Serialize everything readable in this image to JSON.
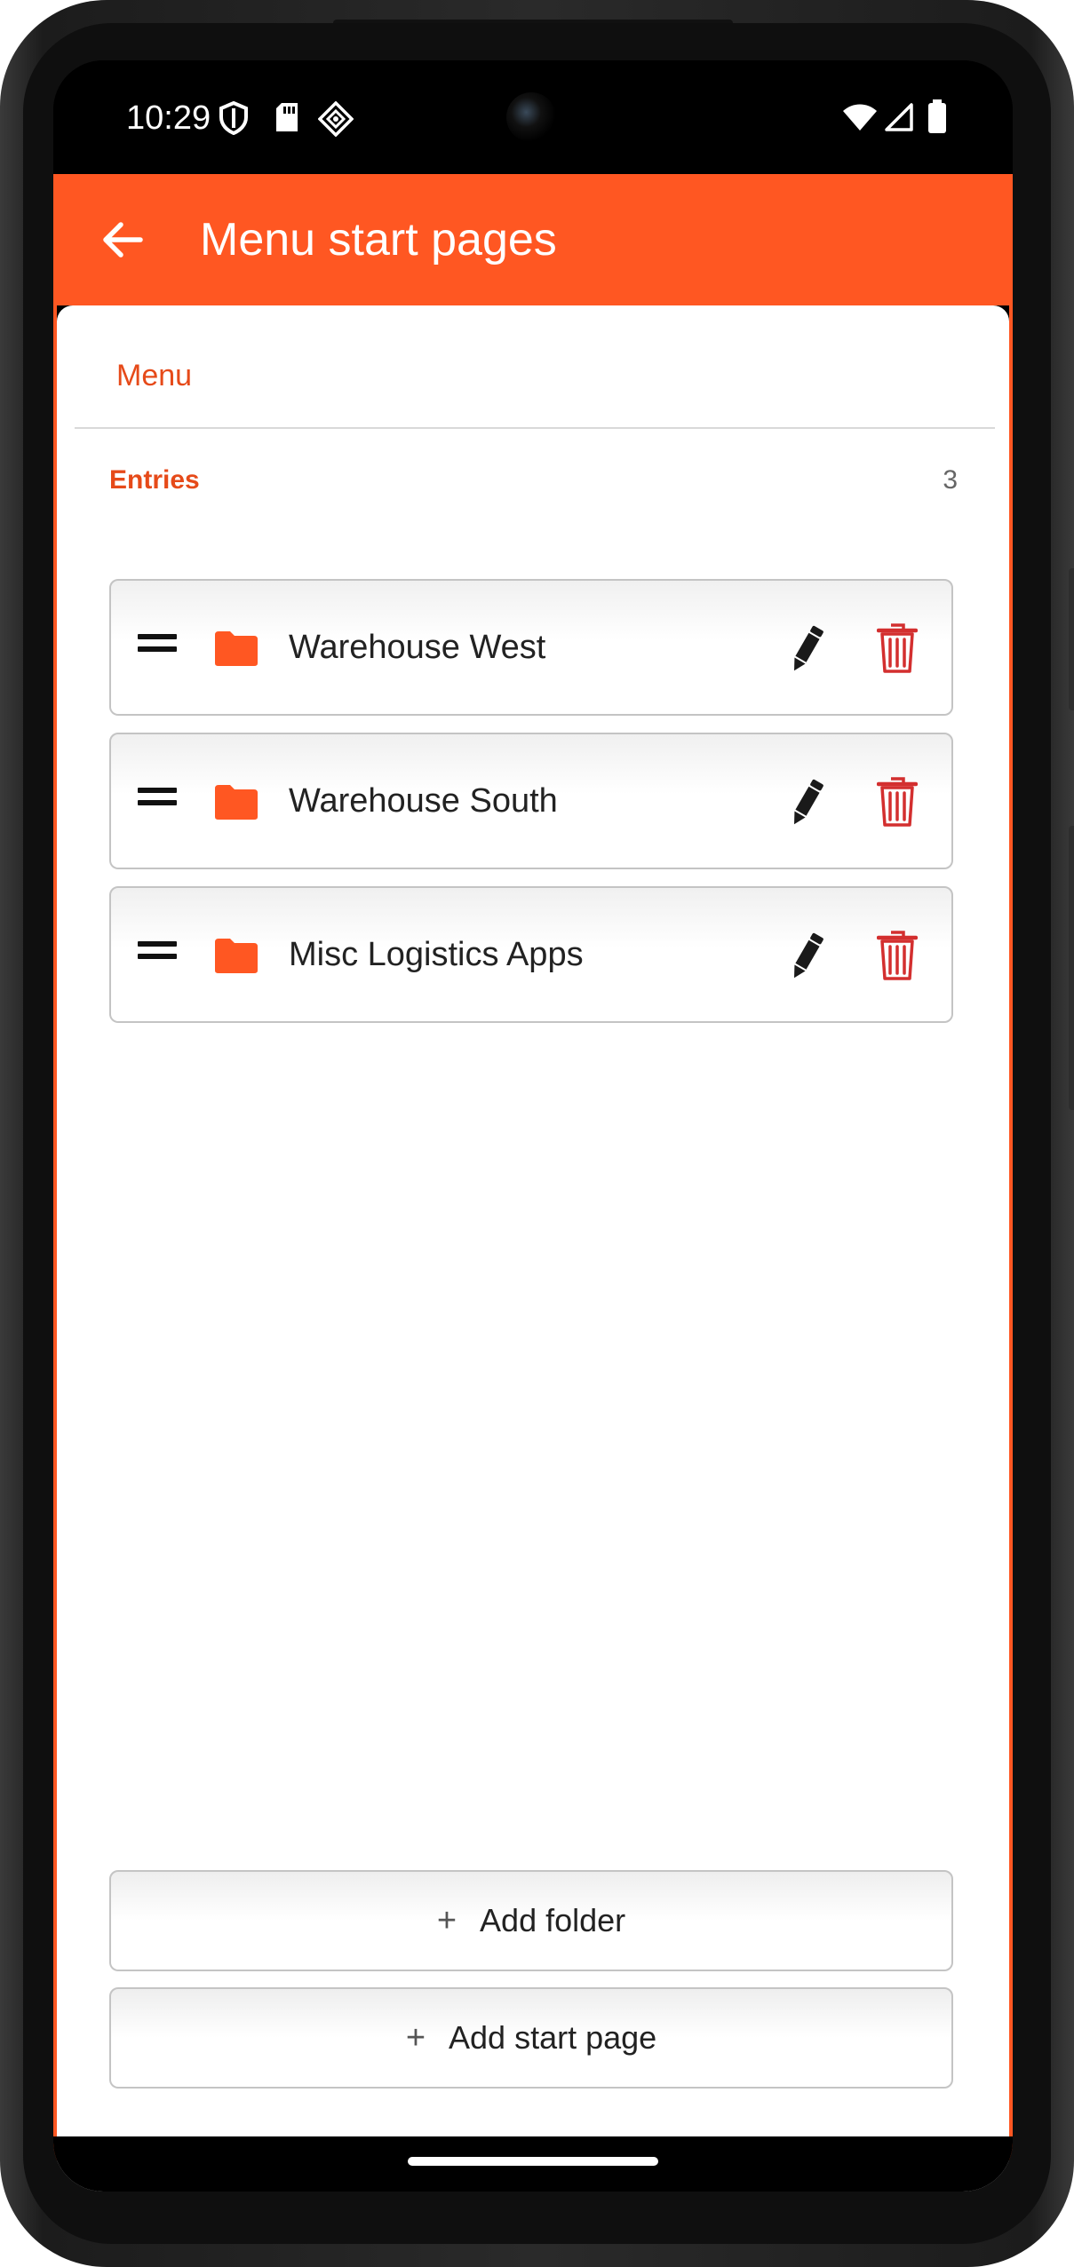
{
  "status_bar": {
    "time": "10:29",
    "left_icons": [
      "shield-icon",
      "sd-card-icon",
      "app-notification-icon"
    ],
    "right_icons": [
      "wifi-icon",
      "cell-signal-icon",
      "battery-icon"
    ]
  },
  "app_bar": {
    "title": "Menu start pages",
    "back_icon": "arrow-back-icon"
  },
  "tabs": [
    {
      "label": "Menu",
      "selected": true
    }
  ],
  "entries": {
    "label": "Entries",
    "count": "3",
    "items": [
      {
        "label": "Warehouse West",
        "icon": "folder-icon"
      },
      {
        "label": "Warehouse South",
        "icon": "folder-icon"
      },
      {
        "label": "Misc Logistics Apps",
        "icon": "folder-icon"
      }
    ]
  },
  "actions": {
    "add_folder_icon": "+",
    "add_folder": "Add folder",
    "add_start_page_icon": "+",
    "add_start_page": "Add start page"
  },
  "colors": {
    "accent": "#ff5722",
    "accent_text": "#e64a19",
    "delete": "#d32f2f"
  }
}
